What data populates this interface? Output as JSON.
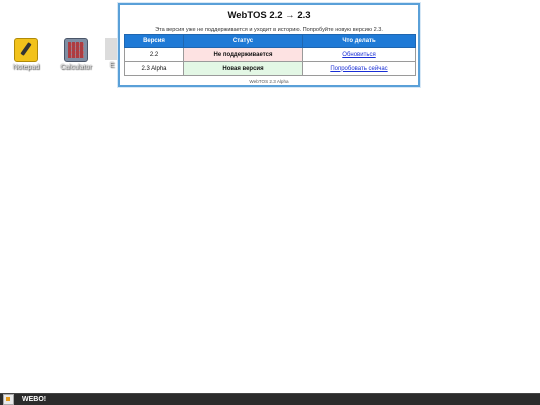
{
  "desktop": {
    "icons": [
      {
        "label": "Notepad"
      },
      {
        "label": "Calculator"
      },
      {
        "label": "E"
      }
    ]
  },
  "dialog": {
    "title": "WebTOS 2.2 → 2.3",
    "description": "Эта версия уже не поддерживается и уходит в историю. Попробуйте новую версию 2.3.",
    "columns": [
      "Версия",
      "Статус",
      "Что делать"
    ],
    "rows": [
      {
        "version": "2.2",
        "status": "Не поддерживается",
        "action": "Обновиться"
      },
      {
        "version": "2.3 Alpha",
        "status": "Новая версия",
        "action": "Попробовать сейчас"
      }
    ],
    "footer": "WebTOS 2.3 Alpha"
  },
  "taskbar": {
    "brand": "WEBO!"
  },
  "colors": {
    "header_blue": "#1f7ad6",
    "unsupported_red": "#c0392b",
    "new_green": "#2e8b3a",
    "dialog_border": "#5aa0d8"
  }
}
